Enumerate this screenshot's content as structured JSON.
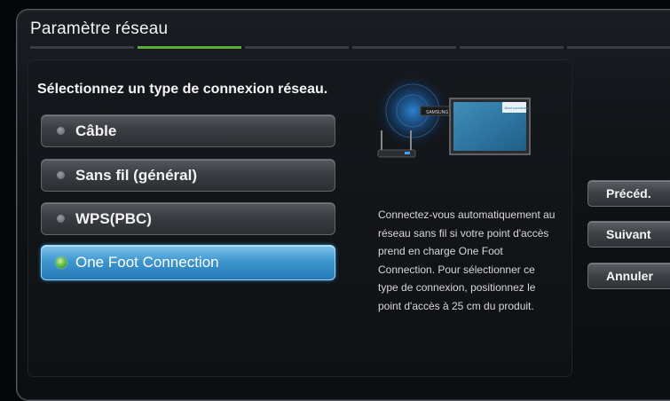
{
  "window": {
    "title": "Paramètre réseau"
  },
  "progress": {
    "steps": 6,
    "active_step": 2
  },
  "prompt": "Sélectionnez un type de connexion réseau.",
  "options": [
    {
      "label": "Câble",
      "selected": false
    },
    {
      "label": "Sans fil (général)",
      "selected": false
    },
    {
      "label": "WPS(PBC)",
      "selected": false
    },
    {
      "label": "One Foot Connection",
      "selected": true
    }
  ],
  "illustration": {
    "device_label": "SAMSUNG",
    "screen_logo": "1foot connection"
  },
  "description": "Connectez-vous automatiquement au réseau sans fil si votre point d'accès prend en charge One Foot Connection. Pour sélectionner ce type de connexion, positionnez le point d'accès à 25 cm du produit.",
  "side_buttons": {
    "prev": "Précéd.",
    "next": "Suivant",
    "cancel": "Annuler"
  },
  "colors": {
    "accent_green": "#5cae3a",
    "selected_blue": "#3f97cf",
    "wifi_glow": "#1f6fb5"
  }
}
